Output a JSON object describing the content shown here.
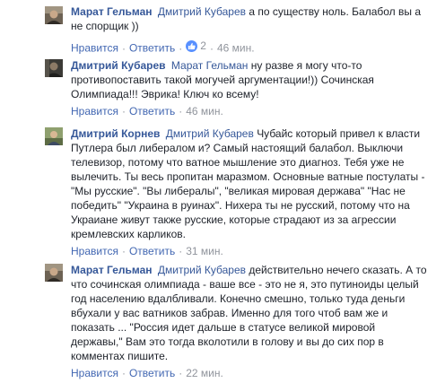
{
  "actions": {
    "like_label": "Нравится",
    "reply_label": "Ответить",
    "separator": "·"
  },
  "comments": [
    {
      "author": "Марат Гельман",
      "mention": "Дмитрий Кубарев",
      "text": "а по существу ноль. Балабол вы а не спорщик ))",
      "likes": "2",
      "time": "46 мин.",
      "avatar_icon": "user-photo-icon"
    },
    {
      "author": "Дмитрий Кубарев",
      "mention": "Марат Гельман",
      "text": "ну разве я могу что-то противопоставить такой могучей аргументации!)) Сочинская Олимпиада!!! Эврика! Ключ ко всему!",
      "time": "46 мин.",
      "avatar_icon": "user-photo-icon"
    },
    {
      "author": "Дмитрий Корнев",
      "mention": "Дмитрий Кубарев",
      "text": "Чубайс который привел к власти Путлера был либералом и? Самый настоящий балабол. Выключи телевизор, потому что ватное мышление это диагноз. Тебя уже не вылечить. Ты весь пропитан маразмом. Основные ватные постулаты - \"Мы русские\". \"Вы либералы\", \"великая мировая держава\" \"Нас не победить\" \"Украина в руинах\". Нихера ты не русский, потому что на Украиане живут также русские, которые страдают из за агрессии кремлевских карликов.",
      "time": "31 мин.",
      "avatar_icon": "user-photo-icon"
    },
    {
      "author": "Марат Гельман",
      "mention": "Дмитрий Кубарев",
      "text": "действительно нечего сказать. А то что сочинская олимпиада - ваше все - это не я, это путиноиды целый год населению вдалбливали. Конечно смешно, только туда деньги вбухали у вас ватников забрав. Именно для того чтоб вам же и показать ... \"Россия идет дальше в статусе великой мировой державы,\" Вам это тогда вколотили в голову и вы до сих пор в комментах пишите.",
      "time": "22 мин.",
      "avatar_icon": "user-photo-icon"
    }
  ],
  "colors": {
    "link": "#365899",
    "action_link": "#4267b2",
    "meta": "#90949c",
    "text": "#1d2129",
    "like_badge": "#5890ff"
  }
}
